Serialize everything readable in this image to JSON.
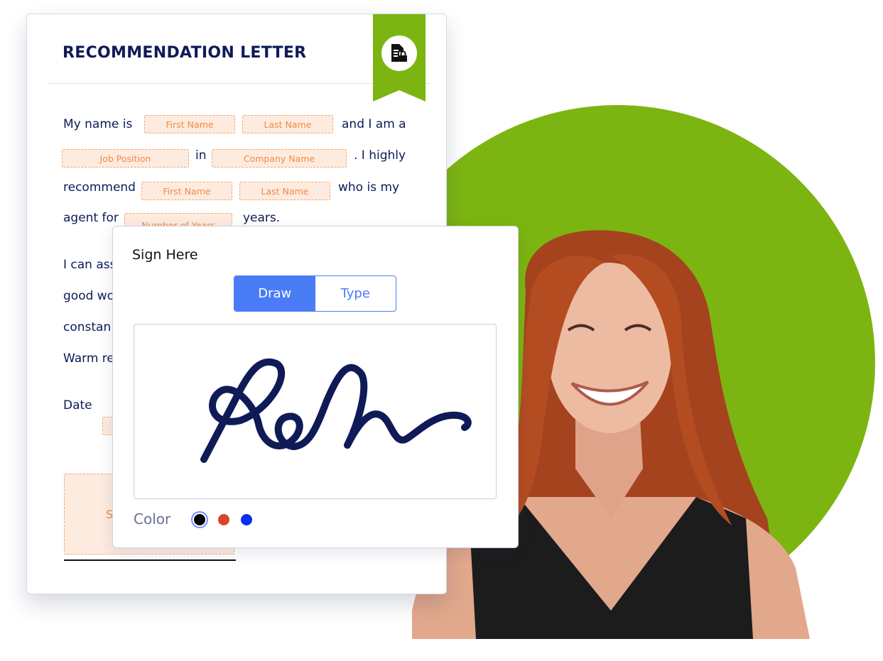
{
  "document": {
    "title": "RECOMMENDATION LETTER",
    "badge_icon": "secure-document-lock-icon",
    "lines": {
      "l1_a": "My name is",
      "l1_b": "and I am a",
      "l2_a": "in",
      "l2_b": ". I highly",
      "l3_a": "recommend",
      "l3_b": "who is my",
      "l4_a": "agent for",
      "l4_b": "years.",
      "p2_1": "I can ass",
      "p2_2": "good wo",
      "p2_3": "constan",
      "p2_4": "Warm re",
      "date": "Date"
    },
    "fields": {
      "first_name_1": "First Name",
      "last_name_1": "Last Name",
      "job_position": "Job Position",
      "company_name": "Company Name",
      "first_name_2": "First Name",
      "last_name_2": "Last Name",
      "number_of_years": "Number of Years",
      "signature_partial": "S"
    }
  },
  "sign_modal": {
    "title": "Sign Here",
    "tabs": [
      {
        "label": "Draw",
        "active": true
      },
      {
        "label": "Type",
        "active": false
      }
    ],
    "color_label": "Color",
    "colors": [
      {
        "hex": "#000000",
        "selected": true
      },
      {
        "hex": "#d5472c",
        "selected": false
      },
      {
        "hex": "#0a2ef0",
        "selected": false
      }
    ],
    "signature_ink": "#0f1a57"
  },
  "colors": {
    "accent_green": "#7cb511",
    "navy": "#0f1a57",
    "field_orange": "#f58a3c",
    "blue": "#4a7cf6"
  }
}
